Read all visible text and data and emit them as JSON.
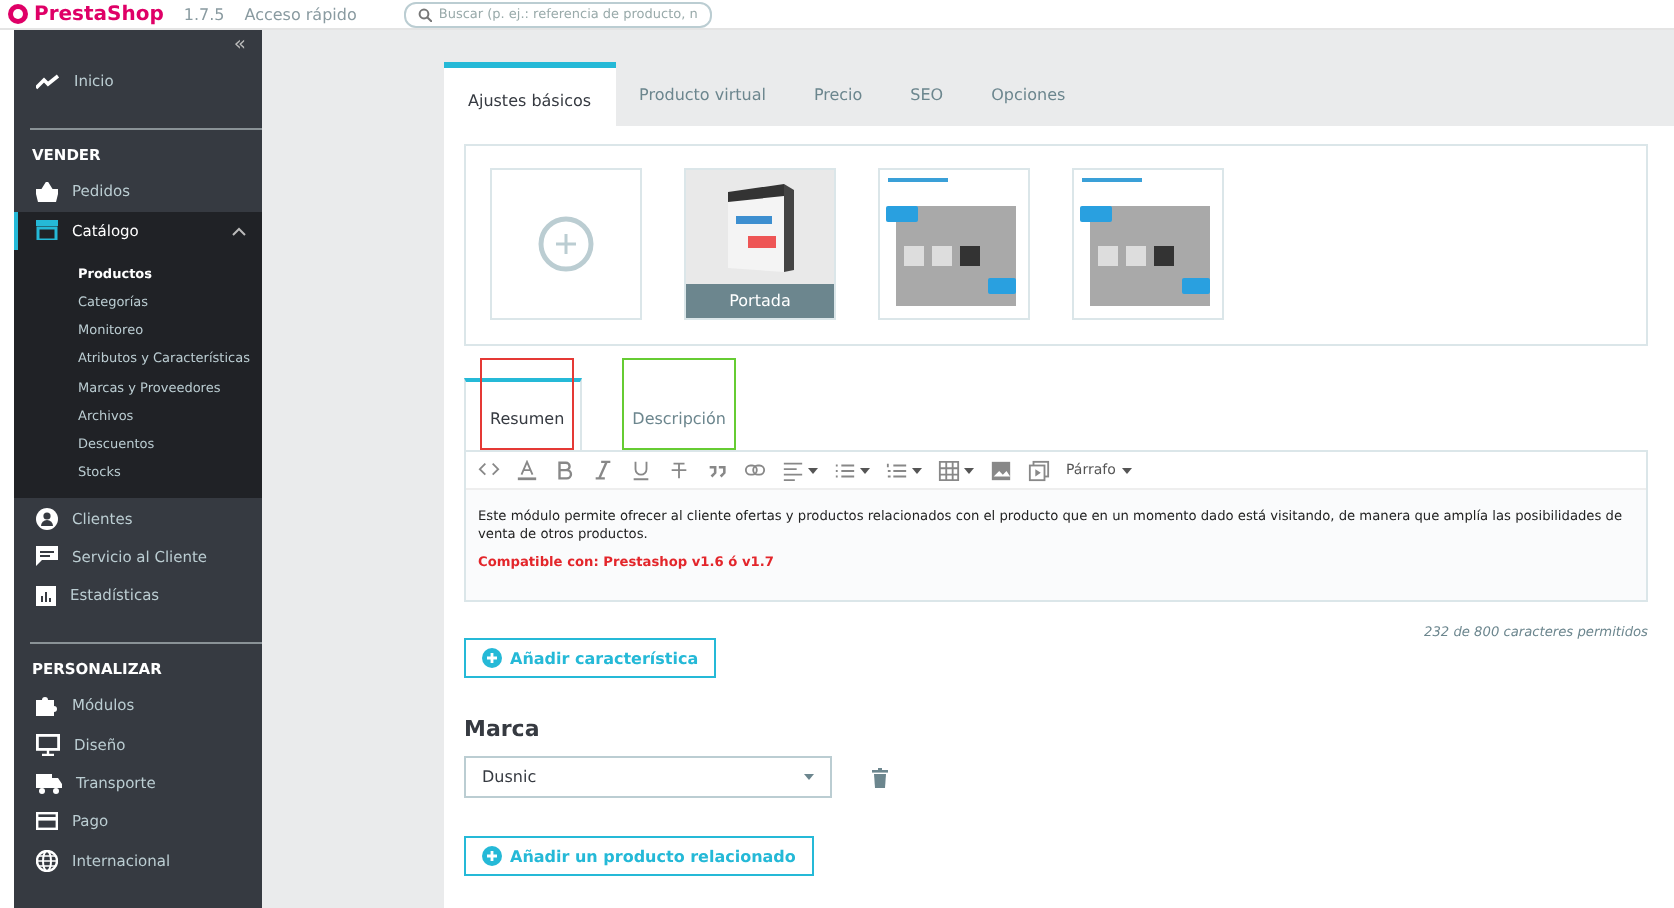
{
  "topbar": {
    "logo": "PrestaShop",
    "version": "1.7.5",
    "quick_access": "Acceso rápido",
    "search": {
      "placeholder": "Buscar (p. ej.: referencia de producto, n"
    }
  },
  "sidebar": {
    "collapse": "«",
    "items": [
      {
        "kind": "item",
        "label": "Inicio",
        "selected": false
      },
      {
        "kind": "section",
        "label": "VENDER"
      },
      {
        "kind": "item",
        "label": "Pedidos",
        "selected": false
      },
      {
        "kind": "item",
        "label": "Catálogo",
        "selected": true,
        "expanded": true,
        "children": [
          {
            "label": "Productos",
            "selected": true
          },
          {
            "label": "Categorías",
            "selected": false
          },
          {
            "label": "Monitoreo",
            "selected": false
          },
          {
            "label": "Atributos y Características",
            "selected": false
          },
          {
            "label": "Marcas y Proveedores",
            "selected": false
          },
          {
            "label": "Archivos",
            "selected": false
          },
          {
            "label": "Descuentos",
            "selected": false
          },
          {
            "label": "Stocks",
            "selected": false
          }
        ]
      },
      {
        "kind": "item",
        "label": "Clientes",
        "selected": false
      },
      {
        "kind": "item",
        "label": "Servicio al Cliente",
        "selected": false
      },
      {
        "kind": "item",
        "label": "Estadísticas",
        "selected": false
      },
      {
        "kind": "section",
        "label": "PERSONALIZAR"
      },
      {
        "kind": "item",
        "label": "Módulos",
        "selected": false
      },
      {
        "kind": "item",
        "label": "Diseño",
        "selected": false
      },
      {
        "kind": "item",
        "label": "Transporte",
        "selected": false
      },
      {
        "kind": "item",
        "label": "Pago",
        "selected": false
      },
      {
        "kind": "item",
        "label": "Internacional",
        "selected": false
      }
    ]
  },
  "tabs": [
    {
      "label": "Ajustes básicos",
      "selected": true
    },
    {
      "label": "Producto virtual",
      "selected": false
    },
    {
      "label": "Precio",
      "selected": false
    },
    {
      "label": "SEO",
      "selected": false
    },
    {
      "label": "Opciones",
      "selected": false
    }
  ],
  "images": [
    {
      "kind": "add"
    },
    {
      "kind": "cover",
      "caption": "Portada"
    },
    {
      "kind": "screenshot"
    },
    {
      "kind": "screenshot"
    }
  ],
  "editor": {
    "tabs": [
      {
        "label": "Resumen",
        "selected": true,
        "color": "#e53935"
      },
      {
        "label": "Descripción",
        "selected": false,
        "color": "#66cc33"
      }
    ],
    "format": "Párrafo",
    "paragraphs": [
      {
        "kind": "normal",
        "text": "Este módulo permite ofrecer al cliente ofertas y productos relacionados con el producto que en un momento dado está visitando, de manera que amplía las posibilidades de venta de otros productos."
      },
      {
        "kind": "highlight",
        "text": "Compatible con: Prestashop v1.6 ó v1.7"
      }
    ],
    "counter": "232 de 800 caracteres permitidos"
  },
  "add_feature": "Añadir característica",
  "brand": {
    "title": "Marca",
    "value": "Dusnic"
  },
  "add_related": "Añadir un producto relacionado"
}
